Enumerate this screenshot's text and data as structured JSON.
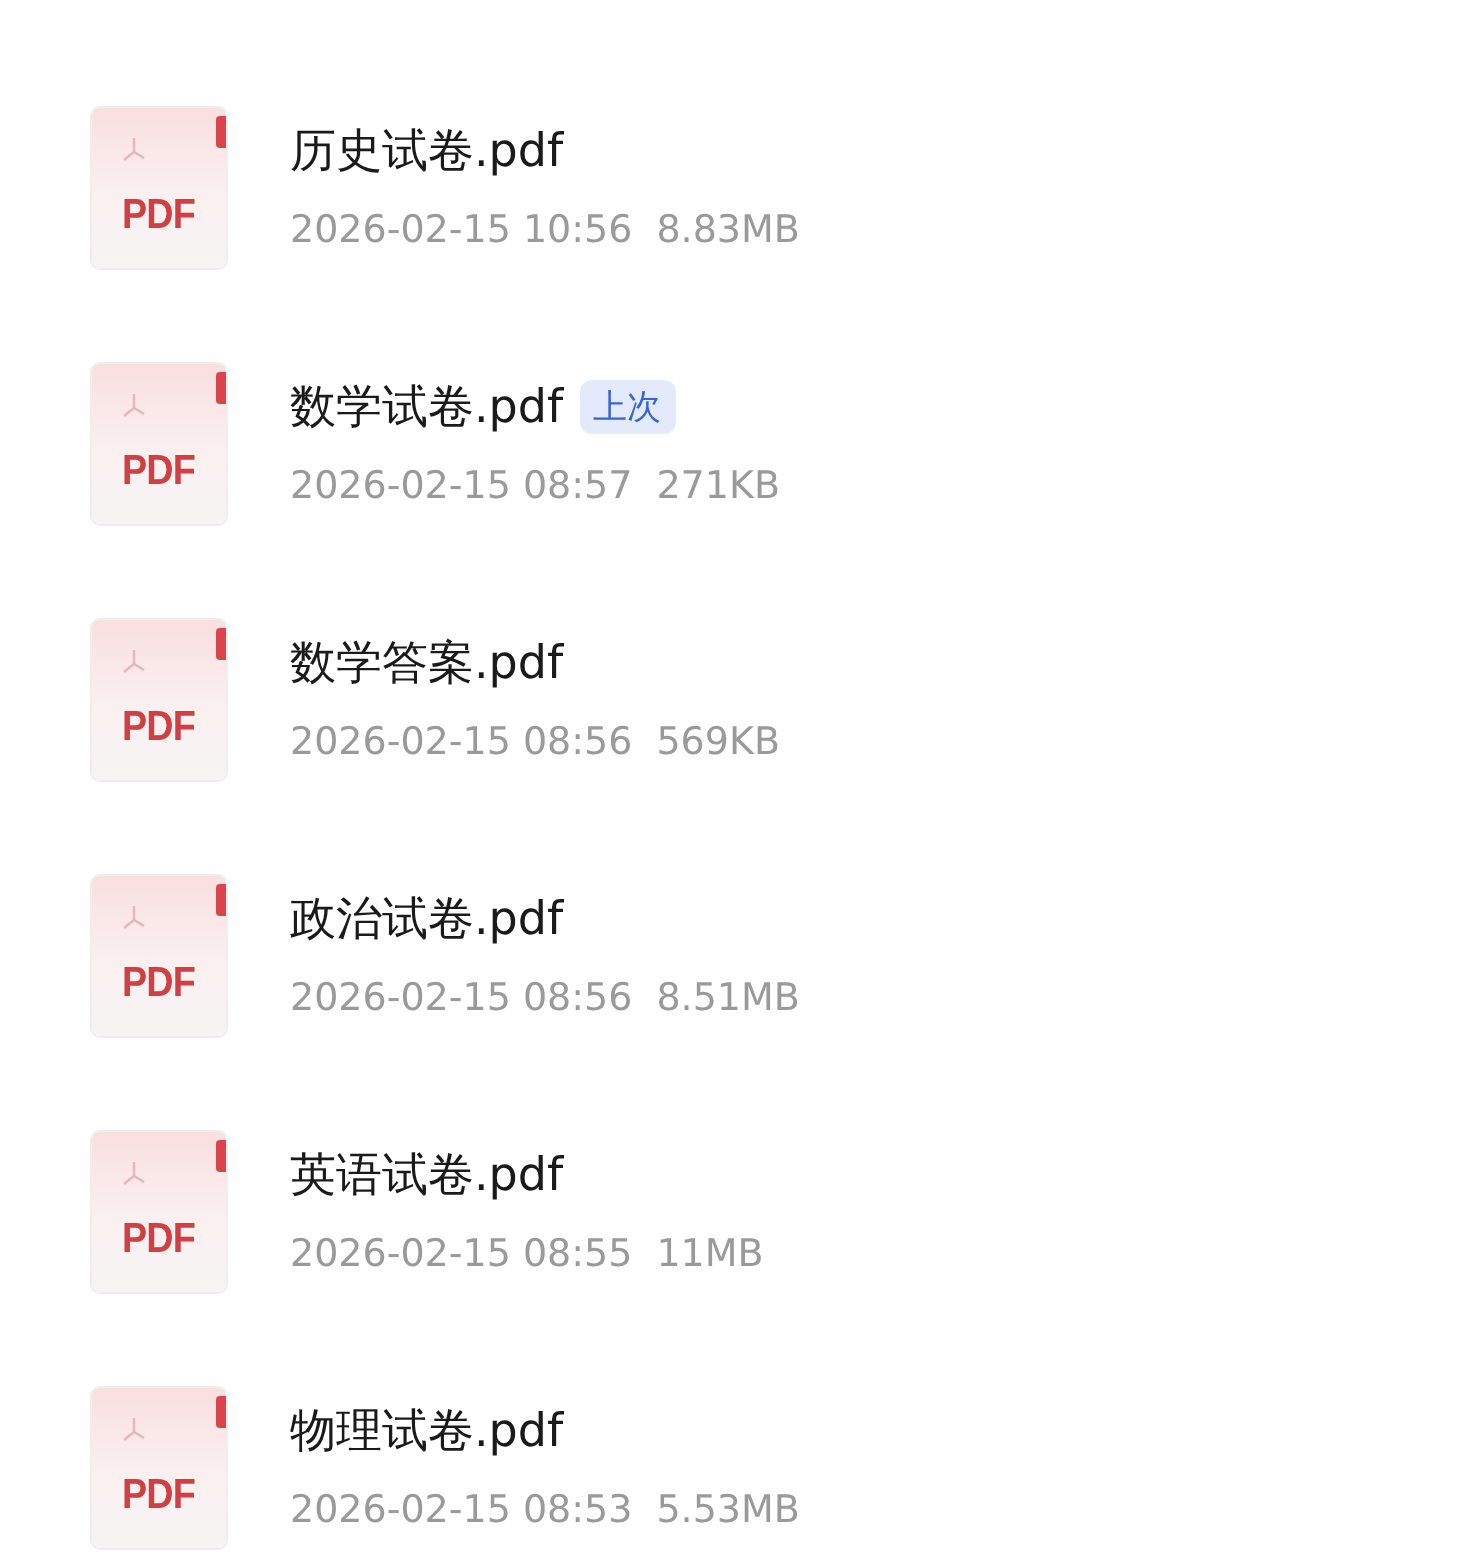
{
  "files": [
    {
      "icon_label": "PDF",
      "name": "历史试卷.pdf",
      "date": "2026-02-15 10:56",
      "size": "8.83MB"
    },
    {
      "icon_label": "PDF",
      "name": "数学试卷.pdf",
      "badge": "上次",
      "date": "2026-02-15 08:57",
      "size": "271KB"
    },
    {
      "icon_label": "PDF",
      "name": "数学答案.pdf",
      "date": "2026-02-15 08:56",
      "size": "569KB"
    },
    {
      "icon_label": "PDF",
      "name": "政治试卷.pdf",
      "date": "2026-02-15 08:56",
      "size": "8.51MB"
    },
    {
      "icon_label": "PDF",
      "name": "英语试卷.pdf",
      "date": "2026-02-15 08:55",
      "size": "11MB"
    },
    {
      "icon_label": "PDF",
      "name": "物理试卷.pdf",
      "date": "2026-02-15 08:53",
      "size": "5.53MB"
    }
  ]
}
